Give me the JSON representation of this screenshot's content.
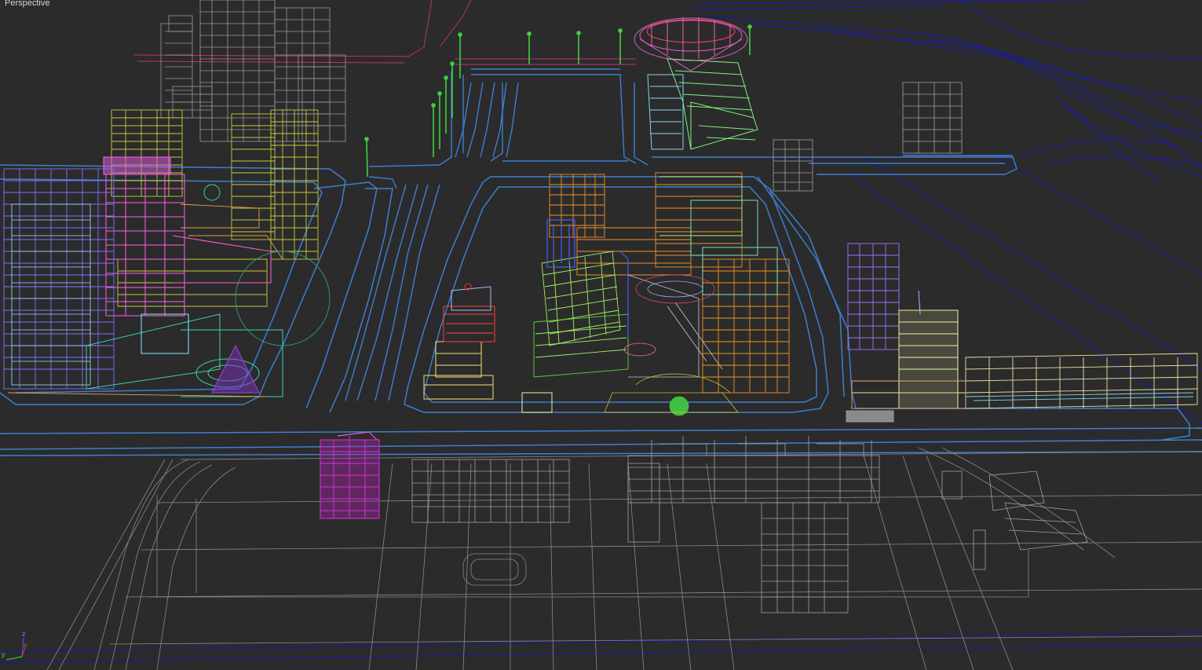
{
  "viewport": {
    "label": "Perspective"
  },
  "axis_gizmo": {
    "x_label": "x",
    "y_label": "y",
    "z_label": "z",
    "x_color": "#d03030",
    "y_color": "#30c030",
    "z_color": "#3060e0"
  },
  "colors": {
    "background": "#2b2b2b",
    "road_blue": "#3c7fd0",
    "dark_blue": "#1a1a9a",
    "grid_gray": "#8a8a8a",
    "light_gray": "#c8c8c8",
    "pink": "#e060c0",
    "magenta": "#c020c0",
    "olive": "#b8b840",
    "orange": "#e08a30",
    "green": "#40d040",
    "cyan": "#60d8d0",
    "yellow": "#e8d870",
    "light_yellow": "#f0f0b0",
    "purple": "#8040e0",
    "red": "#e03030",
    "teal": "#30b0a0"
  }
}
